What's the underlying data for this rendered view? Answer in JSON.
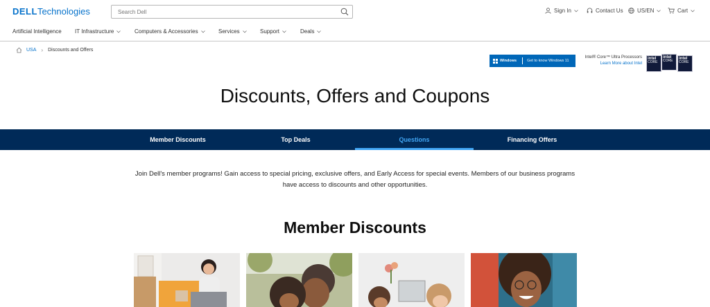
{
  "header": {
    "logo_brand": "DELL",
    "logo_suffix": "Technologies",
    "search_placeholder": "Search Dell",
    "sign_in": "Sign In",
    "contact_us": "Contact Us",
    "locale": "US/EN",
    "cart": "Cart"
  },
  "nav": {
    "items": [
      {
        "label": "Artificial Intelligence"
      },
      {
        "label": "IT Infrastructure"
      },
      {
        "label": "Computers & Accessories"
      },
      {
        "label": "Services"
      },
      {
        "label": "Support"
      },
      {
        "label": "Deals"
      }
    ]
  },
  "breadcrumb": {
    "home": "USA",
    "current": "Discounts and Offers"
  },
  "promos": {
    "windows_brand": "Windows",
    "windows_cta": "Get to know Windows 11",
    "intel_line": "Intel® Core™ Ultra Processors",
    "intel_link": "Learn More about Intel",
    "intel_badge_1": "intel",
    "intel_badge_2": "intel",
    "intel_badge_3": "intel",
    "intel_badge_sub": "CORE"
  },
  "page": {
    "title": "Discounts, Offers and Coupons",
    "intro": "Join Dell's member programs! Gain access to special pricing, exclusive offers, and Early Access for special events. Members of our business programs have access to discounts and other opportunities.",
    "section_title": "Member Discounts"
  },
  "tabs": [
    {
      "label": "Member Discounts",
      "active": false
    },
    {
      "label": "Top Deals",
      "active": false
    },
    {
      "label": "Questions",
      "active": true
    },
    {
      "label": "Financing Offers",
      "active": false
    }
  ],
  "colors": {
    "brand_blue": "#0672cb",
    "tab_bar": "#002a58",
    "tab_active": "#41a6f4"
  }
}
